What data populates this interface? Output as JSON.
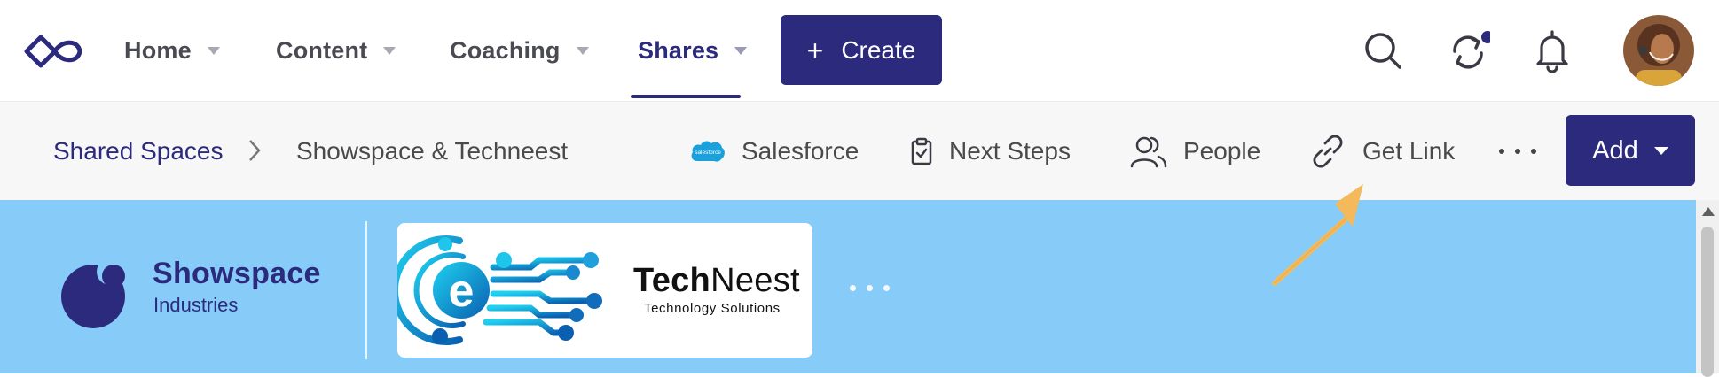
{
  "nav": {
    "items": [
      {
        "label": "Home",
        "active": false
      },
      {
        "label": "Content",
        "active": false
      },
      {
        "label": "Coaching",
        "active": false
      },
      {
        "label": "Shares",
        "active": true
      }
    ],
    "create_plus": "+",
    "create_label": "Create",
    "icons": [
      "search-icon",
      "sync-icon",
      "bell-icon"
    ],
    "notification_dot_color": "#2c2a7c"
  },
  "breadcrumb": {
    "parent": "Shared Spaces",
    "current": "Showspace & Techneest"
  },
  "actions": {
    "salesforce": "Salesforce",
    "salesforce_icon_text": "salesforce",
    "next_steps": "Next Steps",
    "people": "People",
    "get_link": "Get Link",
    "add": "Add"
  },
  "banner": {
    "company": "Showspace",
    "company_sub": "Industries",
    "partner_bold": "Tech",
    "partner_rest": "Neest",
    "partner_sub": "Technology Solutions",
    "partner_glyph": "e"
  },
  "colors": {
    "brand": "#2c2a7c",
    "banner_bg": "#87ccf8",
    "subbar_bg": "#f7f7f7",
    "annotation_arrow": "#f4b95a"
  }
}
